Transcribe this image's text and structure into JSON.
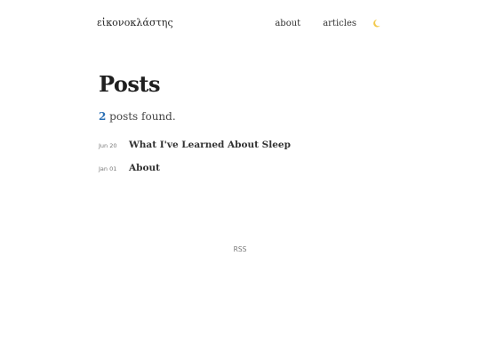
{
  "site": {
    "title": "εἰκονοκλάστης"
  },
  "nav": {
    "items": [
      {
        "label": "about"
      },
      {
        "label": "articles"
      }
    ],
    "theme_icon": "moon-icon",
    "theme_icon_color": "#f2c94c"
  },
  "main": {
    "title": "Posts",
    "count": "2",
    "count_suffix": " posts found.",
    "posts": [
      {
        "date": "Jun 20",
        "title": "What I've Learned About Sleep"
      },
      {
        "date": "Jan 01",
        "title": "About"
      }
    ]
  },
  "footer": {
    "rss_label": "RSS"
  },
  "colors": {
    "accent": "#2a6fb5",
    "text": "#333333"
  }
}
